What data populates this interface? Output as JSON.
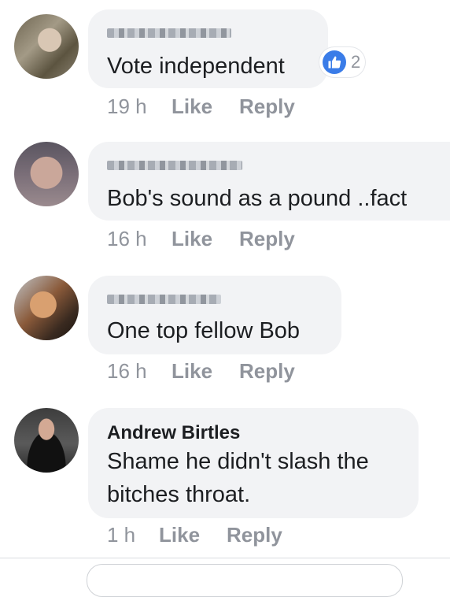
{
  "comments": [
    {
      "author": "",
      "text": "Vote independent",
      "time": "19 h",
      "like_label": "Like",
      "reply_label": "Reply",
      "reaction_count": "2"
    },
    {
      "author": "",
      "text": "Bob's sound as a pound ..fact",
      "time": "16 h",
      "like_label": "Like",
      "reply_label": "Reply"
    },
    {
      "author": "",
      "text": "One top fellow Bob",
      "time": "16 h",
      "like_label": "Like",
      "reply_label": "Reply"
    },
    {
      "author": "Andrew Birtles",
      "text_line1": "Shame he didn't slash the",
      "text_line2": "bitches throat.",
      "time": "1 h",
      "like_label": "Like",
      "reply_label": "Reply"
    }
  ],
  "icons": {
    "reaction": "like-thumb-icon"
  },
  "colors": {
    "bubble": "#f2f3f5",
    "like_blue": "#3a7ce8",
    "meta_gray": "#90949c",
    "text": "#1c1e21"
  }
}
